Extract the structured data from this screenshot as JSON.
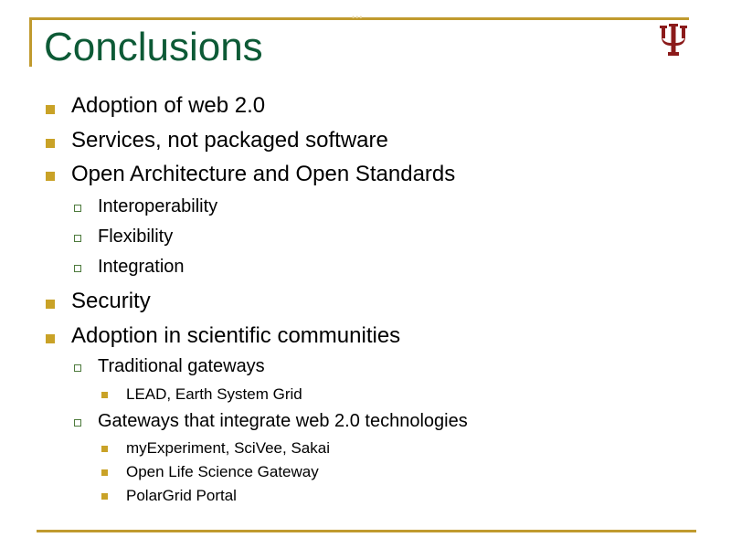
{
  "slide": {
    "title": "Conclusions",
    "logo": "indiana-university-trident-icon",
    "colors": {
      "title": "#0d5a36",
      "frame": "#c09a2e",
      "bullet_level1": "#c9a227",
      "bullet_level2": "#4d7a3c",
      "logo": "#8b1a1a"
    },
    "bullets": [
      {
        "text": "Adoption of web 2.0"
      },
      {
        "text": "Services, not packaged software"
      },
      {
        "text": "Open Architecture and Open Standards",
        "children": [
          {
            "text": "Interoperability"
          },
          {
            "text": "Flexibility"
          },
          {
            "text": "Integration"
          }
        ]
      },
      {
        "text": "Security"
      },
      {
        "text": "Adoption in scientific communities",
        "children": [
          {
            "text": "Traditional gateways",
            "children": [
              {
                "text": "LEAD, Earth System Grid"
              }
            ]
          },
          {
            "text": "Gateways that integrate web 2.0 technologies",
            "children": [
              {
                "text": "myExperiment, SciVee, Sakai"
              },
              {
                "text": "Open Life Science Gateway"
              },
              {
                "text": "PolarGrid Portal"
              }
            ]
          }
        ]
      }
    ]
  }
}
